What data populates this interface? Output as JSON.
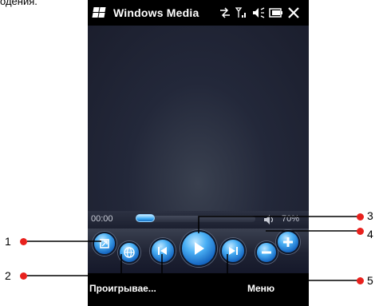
{
  "page_fragment": "одения.",
  "status_bar": {
    "title": "Windows Media",
    "icons": [
      "start-icon",
      "connectivity-icon",
      "signal-icon",
      "volume-icon",
      "battery-icon",
      "close-icon"
    ]
  },
  "seek": {
    "time": "00:00",
    "progress": 0.0,
    "volume": "70%"
  },
  "controls": [
    "skin-icon",
    "globe-icon",
    "previous-icon",
    "play-icon",
    "next-icon",
    "volume-down-icon",
    "volume-up-icon"
  ],
  "softkeys": {
    "left": "Проигрывае...",
    "right": "Меню"
  },
  "callouts": [
    "1",
    "2",
    "3",
    "4",
    "5"
  ],
  "colors": {
    "accent": "#3ba8f2",
    "callout": "#e8211d"
  }
}
